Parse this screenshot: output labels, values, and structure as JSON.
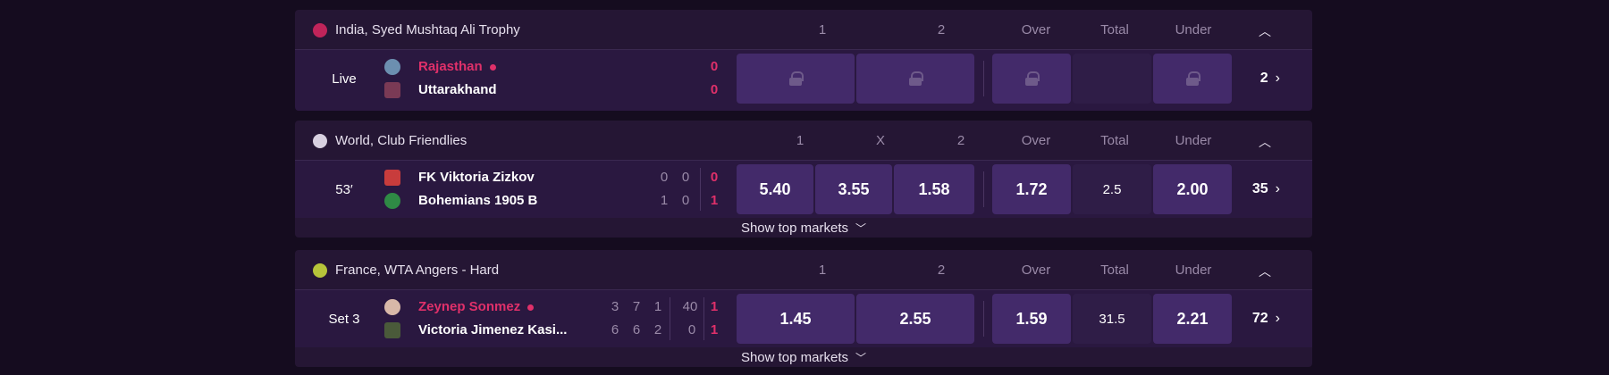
{
  "events": [
    {
      "league": "India, Syed Mushtaq Ali Trophy",
      "sport_icon": "cricket-ball-icon",
      "columns": [
        "1",
        "2",
        "Over",
        "Total",
        "Under"
      ],
      "status": "Live",
      "teams": [
        {
          "name": "Rajasthan",
          "serving": true,
          "scores": [
            "0"
          ]
        },
        {
          "name": "Uttarakhand",
          "serving": false,
          "scores": [
            "0"
          ]
        }
      ],
      "odds": {
        "home": "",
        "away": "",
        "over": "",
        "total": "",
        "under": ""
      },
      "locked": true,
      "markets_count": "2"
    },
    {
      "league": "World, Club Friendlies",
      "sport_icon": "soccer-ball-icon",
      "columns": [
        "1",
        "X",
        "2",
        "Over",
        "Total",
        "Under"
      ],
      "status": "53′",
      "teams": [
        {
          "name": "FK Viktoria Zizkov",
          "serving": false,
          "scores": [
            "0",
            "0",
            "0"
          ]
        },
        {
          "name": "Bohemians 1905 B",
          "serving": false,
          "scores": [
            "1",
            "0",
            "1"
          ]
        }
      ],
      "odds": {
        "home": "5.40",
        "draw": "3.55",
        "away": "1.58",
        "over": "1.72",
        "total": "2.5",
        "under": "2.00"
      },
      "locked": false,
      "markets_count": "35",
      "footer": "Show top markets"
    },
    {
      "league": "France, WTA Angers - Hard",
      "sport_icon": "tennis-ball-icon",
      "columns": [
        "1",
        "2",
        "Over",
        "Total",
        "Under"
      ],
      "status": "Set 3",
      "teams": [
        {
          "name": "Zeynep Sonmez",
          "serving": true,
          "scores": [
            "3",
            "7",
            "1",
            "40",
            "1"
          ]
        },
        {
          "name": "Victoria Jimenez Kasi...",
          "serving": false,
          "scores": [
            "6",
            "6",
            "2",
            "0",
            "1"
          ]
        }
      ],
      "odds": {
        "home": "1.45",
        "away": "2.55",
        "over": "1.59",
        "total": "31.5",
        "under": "2.21"
      },
      "locked": false,
      "markets_count": "72",
      "footer": "Show top markets"
    }
  ],
  "colors": {
    "background": "#150c1f",
    "panel": "#251634",
    "odd_button": "#432a6a",
    "accent": "#e0306a"
  }
}
